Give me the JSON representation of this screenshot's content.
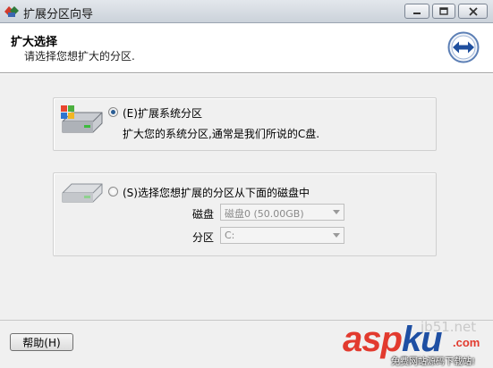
{
  "window": {
    "title": "扩展分区向导",
    "app_icon": "partition-wizard-icon"
  },
  "header": {
    "title": "扩大选择",
    "subtitle": "请选择您想扩大的分区.",
    "icon": "extend-arrows-icon"
  },
  "options": [
    {
      "label": "(E)扩展系统分区",
      "description": "扩大您的系统分区,通常是我们所说的C盘.",
      "selected": true,
      "icon": "system-drive-icon"
    },
    {
      "label": "(S)选择您想扩展的分区从下面的磁盘中",
      "selected": false,
      "icon": "disk-drive-icon",
      "fields": {
        "disk_label": "磁盘",
        "disk_value": "磁盘0 (50.00GB)",
        "partition_label": "分区",
        "partition_value": "C:"
      }
    }
  ],
  "footer": {
    "help_label": "帮助(H)"
  },
  "watermark": {
    "brand_a": "asp",
    "brand_b": "ku",
    "tld": ".com",
    "site": "jb51.net",
    "tagline": "免费网站源码下载站!"
  },
  "colors": {
    "accent": "#2b5d94",
    "watermark_red": "#e23a2e",
    "watermark_blue": "#1e4fa3"
  }
}
